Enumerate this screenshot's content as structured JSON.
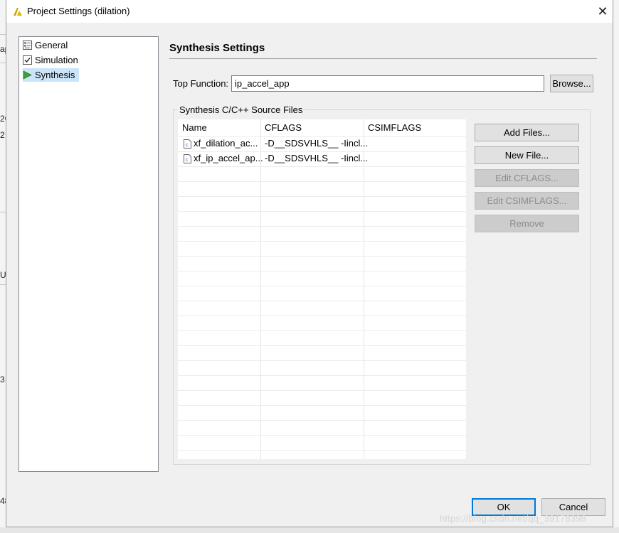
{
  "window": {
    "title": "Project Settings (dilation)",
    "close_glyph": "✕"
  },
  "background_app": {
    "fragments": [
      "ap",
      "2C",
      "2",
      "U",
      "3",
      "48"
    ]
  },
  "tree": {
    "items": [
      {
        "label": "General",
        "icon": "general-settings-icon"
      },
      {
        "label": "Simulation",
        "icon": "checkbox-icon"
      },
      {
        "label": "Synthesis",
        "icon": "play-triangle-icon",
        "selected": true
      }
    ]
  },
  "synthesis": {
    "title": "Synthesis Settings",
    "top_function_label": "Top Function:",
    "top_function_value": "ip_accel_app",
    "browse_label": "Browse...",
    "group_label": "Synthesis C/C++ Source Files",
    "columns": [
      "Name",
      "CFLAGS",
      "CSIMFLAGS"
    ],
    "files": [
      {
        "name": "xf_dilation_ac...",
        "cflags": "-D__SDSVHLS__ -Iincl...",
        "csimflags": ""
      },
      {
        "name": "xf_ip_accel_ap...",
        "cflags": "-D__SDSVHLS__ -Iincl...",
        "csimflags": ""
      }
    ],
    "buttons": {
      "add_files": "Add Files...",
      "new_file": "New File...",
      "edit_cflags": "Edit CFLAGS...",
      "edit_csimflags": "Edit CSIMFLAGS...",
      "remove": "Remove"
    }
  },
  "footer": {
    "ok_label": "OK",
    "cancel_label": "Cancel"
  },
  "watermark": "https://blog.csdn.net/qq_39178398",
  "colors": {
    "selection": "#cce4f7",
    "primary_border": "#0078d7",
    "play_green": "#3aa33a"
  }
}
